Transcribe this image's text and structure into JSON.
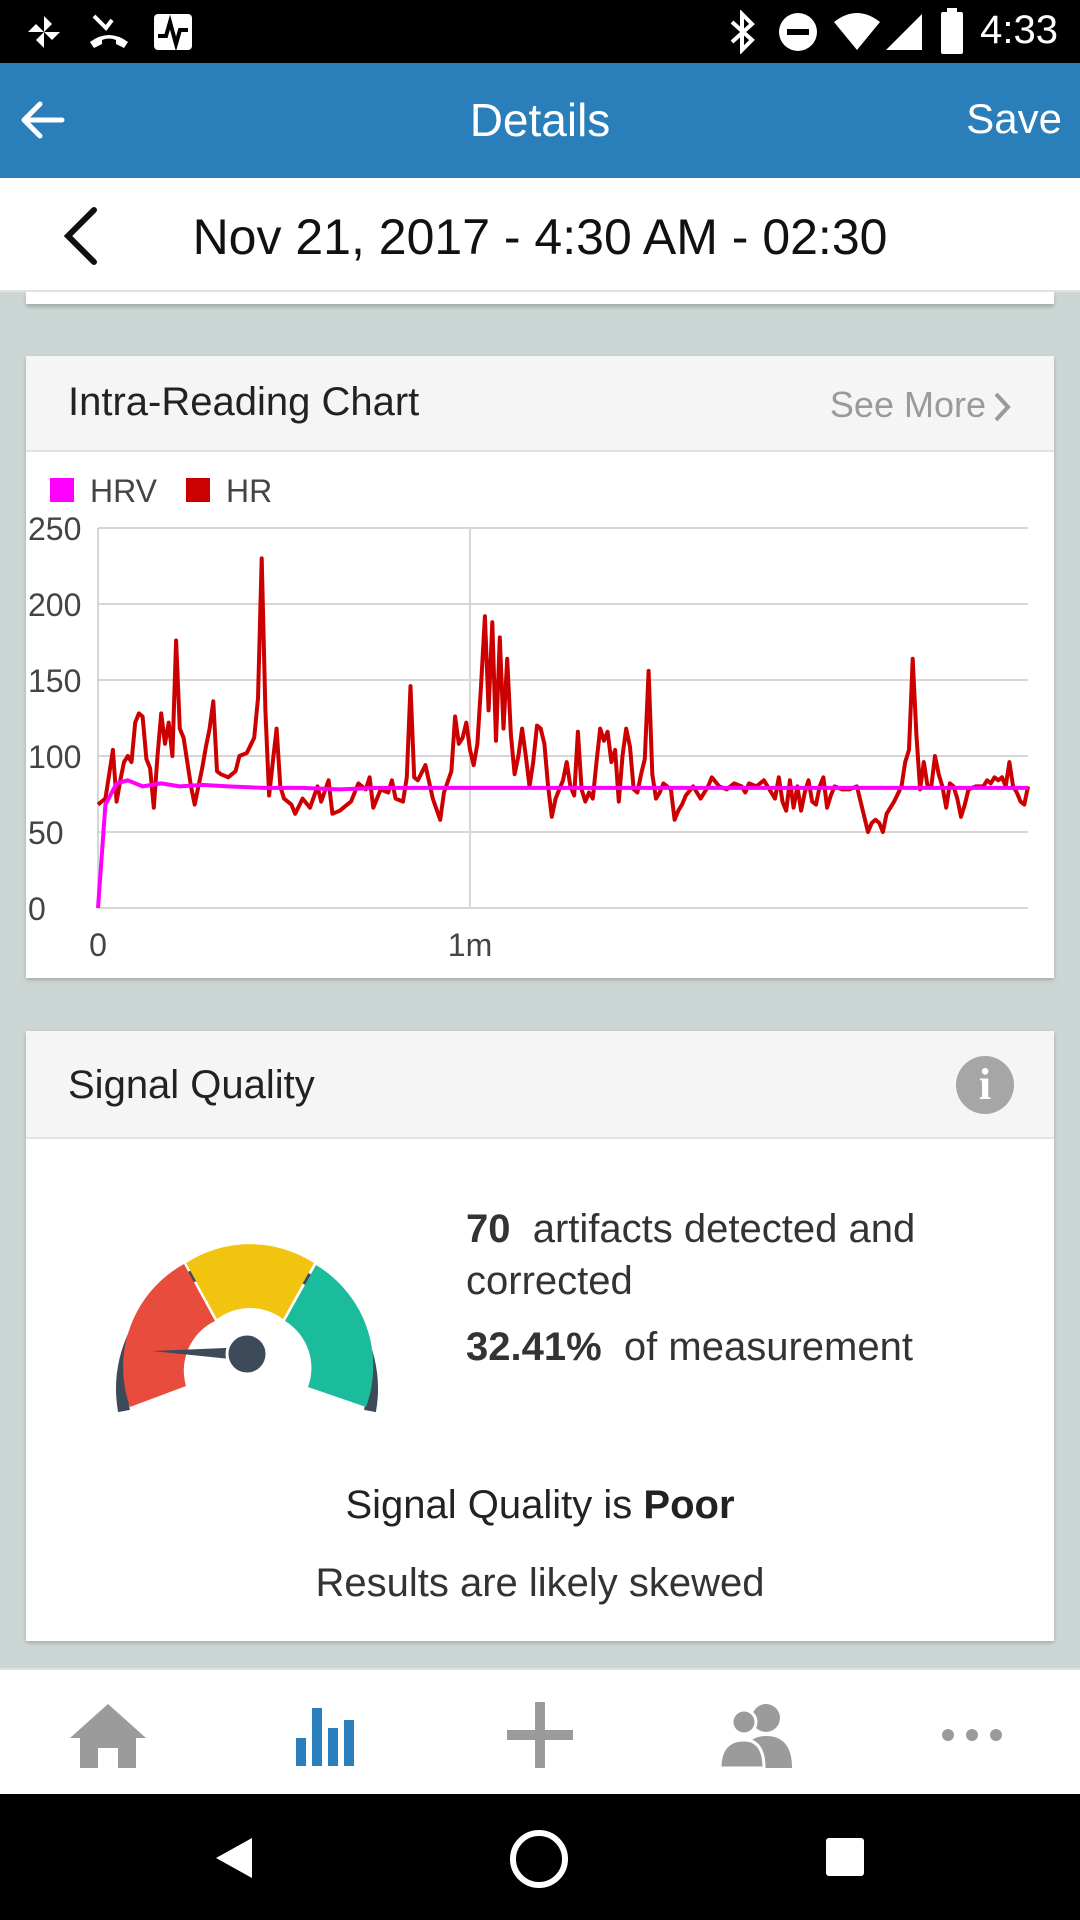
{
  "status_bar": {
    "time": "4:33"
  },
  "app_bar": {
    "title": "Details",
    "save_label": "Save"
  },
  "date_header": {
    "text": "Nov 21, 2017 - 4:30 AM - 02:30"
  },
  "chart_card": {
    "title": "Intra-Reading Chart",
    "see_more": "See More",
    "chart_data": {
      "type": "line",
      "legend_position": "top-left",
      "grid": true,
      "x_range": [
        0,
        2.5
      ],
      "x_ticks": [
        0,
        1
      ],
      "x_tick_labels": [
        "0",
        "1m"
      ],
      "ylim": [
        0,
        250
      ],
      "y_ticks": [
        0,
        50,
        100,
        150,
        200,
        250
      ],
      "y_tick_labels": [
        "0",
        "50",
        "100",
        "150",
        "200",
        "250"
      ],
      "series": [
        {
          "name": "HRV",
          "color": "#ff00ff",
          "points": [
            [
              0,
              0
            ],
            [
              0.02,
              68
            ],
            [
              0.05,
              82
            ],
            [
              0.08,
              84
            ],
            [
              0.12,
              80
            ],
            [
              0.17,
              82
            ],
            [
              0.22,
              80
            ],
            [
              0.28,
              81
            ],
            [
              0.35,
              80
            ],
            [
              0.45,
              79
            ],
            [
              0.55,
              79
            ],
            [
              0.65,
              78
            ],
            [
              0.75,
              79
            ],
            [
              0.85,
              79
            ],
            [
              0.95,
              79
            ],
            [
              1.05,
              79
            ],
            [
              1.15,
              79
            ],
            [
              1.3,
              79
            ],
            [
              1.45,
              79
            ],
            [
              1.6,
              79
            ],
            [
              1.75,
              79
            ],
            [
              1.9,
              79
            ],
            [
              2.05,
              79
            ],
            [
              2.2,
              79
            ],
            [
              2.35,
              79
            ],
            [
              2.5,
              79
            ]
          ]
        },
        {
          "name": "HR",
          "color": "#cc0000",
          "points": [
            [
              0,
              68
            ],
            [
              0.02,
              72
            ],
            [
              0.03,
              88
            ],
            [
              0.04,
              104
            ],
            [
              0.05,
              70
            ],
            [
              0.06,
              84
            ],
            [
              0.07,
              96
            ],
            [
              0.08,
              100
            ],
            [
              0.09,
              96
            ],
            [
              0.1,
              122
            ],
            [
              0.11,
              128
            ],
            [
              0.12,
              126
            ],
            [
              0.13,
              98
            ],
            [
              0.14,
              92
            ],
            [
              0.15,
              66
            ],
            [
              0.16,
              100
            ],
            [
              0.17,
              128
            ],
            [
              0.18,
              108
            ],
            [
              0.19,
              122
            ],
            [
              0.2,
              100
            ],
            [
              0.21,
              176
            ],
            [
              0.22,
              118
            ],
            [
              0.23,
              112
            ],
            [
              0.24,
              96
            ],
            [
              0.25,
              80
            ],
            [
              0.26,
              68
            ],
            [
              0.27,
              80
            ],
            [
              0.28,
              92
            ],
            [
              0.29,
              106
            ],
            [
              0.3,
              118
            ],
            [
              0.31,
              136
            ],
            [
              0.32,
              90
            ],
            [
              0.33,
              88
            ],
            [
              0.35,
              86
            ],
            [
              0.37,
              90
            ],
            [
              0.38,
              100
            ],
            [
              0.4,
              102
            ],
            [
              0.42,
              112
            ],
            [
              0.43,
              138
            ],
            [
              0.44,
              230
            ],
            [
              0.45,
              130
            ],
            [
              0.46,
              74
            ],
            [
              0.47,
              96
            ],
            [
              0.48,
              118
            ],
            [
              0.49,
              80
            ],
            [
              0.5,
              72
            ],
            [
              0.52,
              68
            ],
            [
              0.53,
              62
            ],
            [
              0.55,
              72
            ],
            [
              0.57,
              66
            ],
            [
              0.59,
              80
            ],
            [
              0.6,
              70
            ],
            [
              0.62,
              84
            ],
            [
              0.63,
              62
            ],
            [
              0.65,
              64
            ],
            [
              0.67,
              68
            ],
            [
              0.68,
              70
            ],
            [
              0.7,
              82
            ],
            [
              0.72,
              78
            ],
            [
              0.73,
              86
            ],
            [
              0.74,
              66
            ],
            [
              0.76,
              78
            ],
            [
              0.78,
              76
            ],
            [
              0.79,
              84
            ],
            [
              0.8,
              72
            ],
            [
              0.82,
              70
            ],
            [
              0.83,
              86
            ],
            [
              0.84,
              146
            ],
            [
              0.85,
              86
            ],
            [
              0.86,
              84
            ],
            [
              0.88,
              94
            ],
            [
              0.9,
              72
            ],
            [
              0.92,
              58
            ],
            [
              0.93,
              76
            ],
            [
              0.95,
              90
            ],
            [
              0.96,
              126
            ],
            [
              0.97,
              108
            ],
            [
              0.98,
              112
            ],
            [
              0.99,
              122
            ],
            [
              1.0,
              104
            ],
            [
              1.01,
              94
            ],
            [
              1.02,
              108
            ],
            [
              1.03,
              148
            ],
            [
              1.04,
              192
            ],
            [
              1.05,
              130
            ],
            [
              1.06,
              188
            ],
            [
              1.07,
              110
            ],
            [
              1.08,
              178
            ],
            [
              1.09,
              118
            ],
            [
              1.1,
              164
            ],
            [
              1.11,
              114
            ],
            [
              1.12,
              88
            ],
            [
              1.13,
              100
            ],
            [
              1.14,
              118
            ],
            [
              1.15,
              100
            ],
            [
              1.16,
              80
            ],
            [
              1.17,
              96
            ],
            [
              1.18,
              120
            ],
            [
              1.19,
              118
            ],
            [
              1.2,
              108
            ],
            [
              1.21,
              80
            ],
            [
              1.22,
              60
            ],
            [
              1.23,
              72
            ],
            [
              1.24,
              78
            ],
            [
              1.25,
              84
            ],
            [
              1.26,
              96
            ],
            [
              1.27,
              80
            ],
            [
              1.28,
              74
            ],
            [
              1.29,
              116
            ],
            [
              1.3,
              78
            ],
            [
              1.31,
              70
            ],
            [
              1.32,
              76
            ],
            [
              1.33,
              72
            ],
            [
              1.34,
              96
            ],
            [
              1.35,
              118
            ],
            [
              1.36,
              110
            ],
            [
              1.37,
              116
            ],
            [
              1.38,
              96
            ],
            [
              1.39,
              104
            ],
            [
              1.4,
              70
            ],
            [
              1.41,
              100
            ],
            [
              1.42,
              118
            ],
            [
              1.43,
              106
            ],
            [
              1.44,
              78
            ],
            [
              1.45,
              76
            ],
            [
              1.46,
              88
            ],
            [
              1.47,
              98
            ],
            [
              1.48,
              156
            ],
            [
              1.49,
              88
            ],
            [
              1.5,
              72
            ],
            [
              1.51,
              76
            ],
            [
              1.52,
              82
            ],
            [
              1.53,
              80
            ],
            [
              1.54,
              78
            ],
            [
              1.55,
              58
            ],
            [
              1.56,
              64
            ],
            [
              1.57,
              68
            ],
            [
              1.58,
              74
            ],
            [
              1.6,
              80
            ],
            [
              1.61,
              76
            ],
            [
              1.62,
              72
            ],
            [
              1.64,
              80
            ],
            [
              1.65,
              86
            ],
            [
              1.67,
              80
            ],
            [
              1.69,
              78
            ],
            [
              1.71,
              82
            ],
            [
              1.73,
              80
            ],
            [
              1.74,
              76
            ],
            [
              1.75,
              82
            ],
            [
              1.77,
              80
            ],
            [
              1.79,
              84
            ],
            [
              1.8,
              80
            ],
            [
              1.81,
              76
            ],
            [
              1.82,
              72
            ],
            [
              1.83,
              86
            ],
            [
              1.84,
              70
            ],
            [
              1.85,
              64
            ],
            [
              1.86,
              84
            ],
            [
              1.87,
              66
            ],
            [
              1.88,
              80
            ],
            [
              1.89,
              64
            ],
            [
              1.9,
              76
            ],
            [
              1.91,
              84
            ],
            [
              1.92,
              70
            ],
            [
              1.93,
              68
            ],
            [
              1.94,
              80
            ],
            [
              1.95,
              86
            ],
            [
              1.96,
              66
            ],
            [
              1.97,
              74
            ],
            [
              1.98,
              80
            ],
            [
              2.0,
              78
            ],
            [
              2.02,
              78
            ],
            [
              2.04,
              80
            ],
            [
              2.06,
              60
            ],
            [
              2.07,
              50
            ],
            [
              2.08,
              56
            ],
            [
              2.09,
              58
            ],
            [
              2.1,
              56
            ],
            [
              2.11,
              50
            ],
            [
              2.12,
              62
            ],
            [
              2.14,
              70
            ],
            [
              2.16,
              80
            ],
            [
              2.17,
              96
            ],
            [
              2.18,
              104
            ],
            [
              2.19,
              164
            ],
            [
              2.2,
              114
            ],
            [
              2.21,
              78
            ],
            [
              2.22,
              96
            ],
            [
              2.23,
              80
            ],
            [
              2.24,
              80
            ],
            [
              2.25,
              100
            ],
            [
              2.26,
              88
            ],
            [
              2.27,
              80
            ],
            [
              2.28,
              66
            ],
            [
              2.29,
              82
            ],
            [
              2.3,
              80
            ],
            [
              2.31,
              72
            ],
            [
              2.32,
              60
            ],
            [
              2.33,
              68
            ],
            [
              2.34,
              78
            ],
            [
              2.36,
              80
            ],
            [
              2.38,
              80
            ],
            [
              2.39,
              84
            ],
            [
              2.4,
              82
            ],
            [
              2.41,
              86
            ],
            [
              2.42,
              84
            ],
            [
              2.43,
              86
            ],
            [
              2.44,
              80
            ],
            [
              2.45,
              96
            ],
            [
              2.46,
              80
            ],
            [
              2.47,
              76
            ],
            [
              2.48,
              70
            ],
            [
              2.49,
              68
            ],
            [
              2.5,
              80
            ]
          ]
        }
      ]
    }
  },
  "signal_quality": {
    "title": "Signal Quality",
    "info_glyph": "i",
    "artifacts_count": "70",
    "artifacts_text": "artifacts detected and",
    "artifacts_text_2": "corrected",
    "percent": "32.41%",
    "percent_text": "of measurement",
    "quality_prefix": "Signal Quality is",
    "quality_value": "Poor",
    "note": "Results are likely skewed",
    "gauge_level": 0.1,
    "gauge_colors": {
      "red": "#e74c3c",
      "yellow": "#f1c40f",
      "green": "#1abc9c",
      "dark": "#3d4a5a"
    }
  },
  "colors": {
    "accent": "#2a7fba",
    "hrv": "#ff00ff",
    "hr": "#cc0000"
  },
  "bottom_nav": {
    "items": [
      {
        "icon": "home-icon"
      },
      {
        "icon": "bar-chart-icon",
        "active": true
      },
      {
        "icon": "plus-icon"
      },
      {
        "icon": "group-icon"
      },
      {
        "icon": "more-icon"
      }
    ]
  }
}
